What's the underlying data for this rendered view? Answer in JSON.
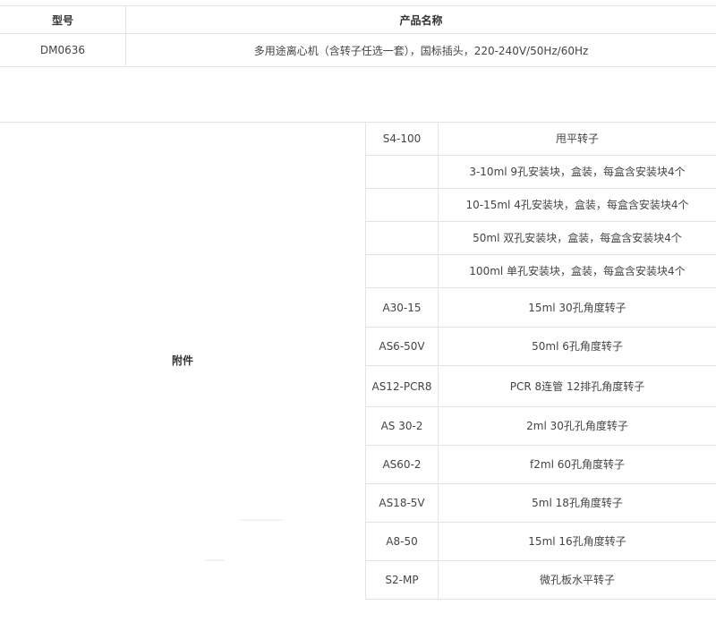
{
  "spec_table": {
    "headers": [
      "型号",
      "产品名称"
    ],
    "rows": [
      [
        "DM0636",
        "多用途离心机（含转子任选一套），国标插头，220-240V/50Hz/60Hz"
      ]
    ]
  },
  "accessories": {
    "label": "附件",
    "rows": [
      {
        "model": "S4-100",
        "desc": "甩平转子"
      },
      {
        "model": "",
        "desc": "3-10ml 9孔安装块，盒装，每盒含安装块4个"
      },
      {
        "model": "",
        "desc": "10-15ml 4孔安装块，盒装，每盒含安装块4个"
      },
      {
        "model": "",
        "desc": "50ml 双孔安装块，盒装，每盒含安装块4个"
      },
      {
        "model": "",
        "desc": "100ml 单孔安装块，盒装，每盒含安装块4个"
      },
      {
        "model": "A30-15",
        "desc": "15ml 30孔角度转子"
      },
      {
        "model": "AS6-50V",
        "desc": "50ml 6孔角度转子"
      },
      {
        "model": "AS12-PCR8",
        "desc": "PCR 8连管 12排孔角度转子"
      },
      {
        "model": "AS 30-2",
        "desc": "2ml  30孔孔角度转子"
      },
      {
        "model": "AS60-2",
        "desc": "f2ml  60孔角度转子"
      },
      {
        "model": "AS18-5V",
        "desc": "5ml  18孔角度转子"
      },
      {
        "model": "A8-50",
        "desc": "15ml  16孔角度转子"
      },
      {
        "model": "S2-MP",
        "desc": "微孔板水平转子"
      }
    ]
  }
}
